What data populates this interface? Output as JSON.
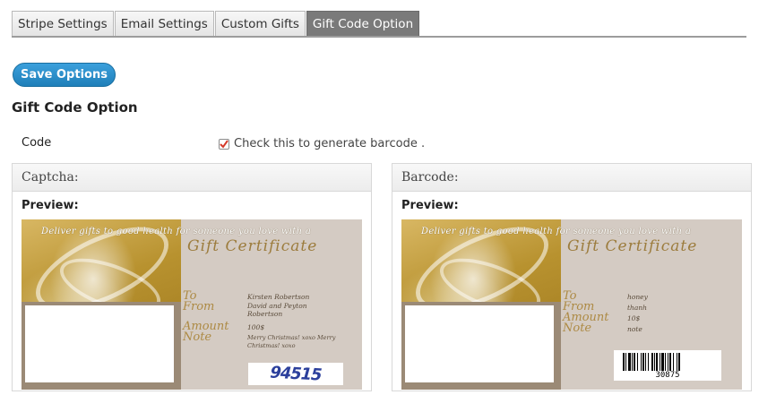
{
  "tabs": [
    {
      "label": "Stripe Settings",
      "active": false
    },
    {
      "label": "Email Settings",
      "active": false
    },
    {
      "label": "Custom Gifts",
      "active": false
    },
    {
      "label": "Gift Code Option",
      "active": true
    }
  ],
  "save_button": "Save Options",
  "section_title": "Gift Code Option",
  "code_row": {
    "label": "Code",
    "checkbox_text": "Check this to generate barcode .",
    "checked": true
  },
  "captcha_panel": {
    "title": "Captcha:",
    "preview_label": "Preview:",
    "certificate": {
      "headline": "Deliver gifts to good health for someone you love with a",
      "title": "Gift Certificate",
      "labels": {
        "to": "To",
        "from": "From",
        "amount": "Amount",
        "note": "Note"
      },
      "to": "Kirsten Robertson",
      "from": "David and Peyton Robertson",
      "amount": "100$",
      "note": "Merry Christmas! xoxo Merry Christmas! xoxo"
    },
    "captcha_code": "94515"
  },
  "barcode_panel": {
    "title": "Barcode:",
    "preview_label": "Preview:",
    "certificate": {
      "headline": "Deliver gifts to good health for someone you love with a",
      "title": "Gift Certificate",
      "labels": {
        "to": "To",
        "from": "From",
        "amount": "Amount",
        "note": "Note"
      },
      "to": "honey",
      "from": "thanh",
      "amount": "10$",
      "note": "note"
    },
    "barcode_number": "30875"
  },
  "colors": {
    "save_button": "#2a8dc9",
    "active_tab": "#7a7a7a",
    "certificate_gold": "#ad8a44",
    "captcha_text": "#2b3f9c",
    "checkbox_check": "#d43a2a"
  }
}
